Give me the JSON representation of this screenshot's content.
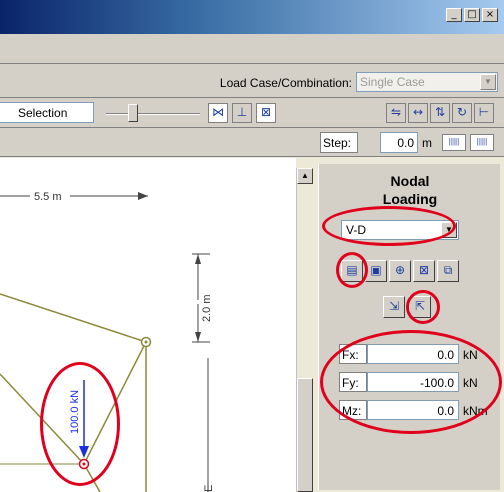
{
  "window": {
    "minimize": "_",
    "maximize": "□",
    "close": "×"
  },
  "toolbar": {
    "load_case_label": "Load Case/Combination:",
    "load_case_value": "Single Case",
    "selection_label": "Selection",
    "step_label": "Step:",
    "step_value": "0.0",
    "step_unit": "m"
  },
  "canvas": {
    "dim_top": "5.5 m",
    "dim_right": "2.0 m",
    "load_label": "100.0 kN"
  },
  "panel": {
    "title_line1": "Nodal",
    "title_line2": "Loading",
    "case_value": "V-D",
    "fields": [
      {
        "label": "Fx:",
        "value": "0.0",
        "unit": "kN"
      },
      {
        "label": "Fy:",
        "value": "-100.0",
        "unit": "kN"
      },
      {
        "label": "Mz:",
        "value": "0.0",
        "unit": "kNm"
      }
    ]
  },
  "colors": {
    "highlight": "#e0001b",
    "member": "#8a8a3a",
    "load_arrow": "#1d2fe0",
    "dimension": "#444444"
  }
}
